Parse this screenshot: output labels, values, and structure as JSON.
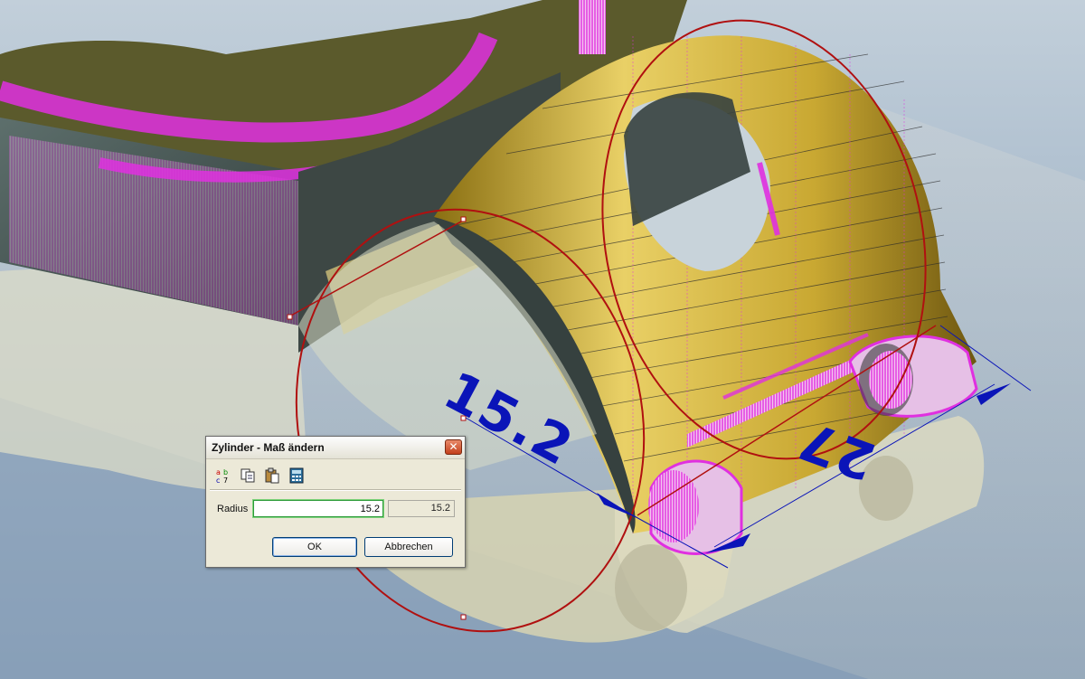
{
  "viewport": {
    "dimension_radius": "15.2",
    "dimension_width": "27",
    "colors": {
      "model_gold": "#c9a832",
      "model_shadow": "#3f4a46",
      "mesh_magenta": "#e030e0",
      "edge_red": "#b01010",
      "dimension_blue": "#0a14b8",
      "floor_gray": "#b9c3c9"
    }
  },
  "dialog": {
    "title": "Zylinder - Maß ändern",
    "close_icon": "close-icon",
    "toolbar": [
      "abc-icon",
      "copy-icon",
      "paste-icon",
      "calculator-icon"
    ],
    "radius_label": "Radius",
    "radius_value": "15.2",
    "radius_previous": "15.2",
    "ok_label": "OK",
    "cancel_label": "Abbrechen"
  }
}
